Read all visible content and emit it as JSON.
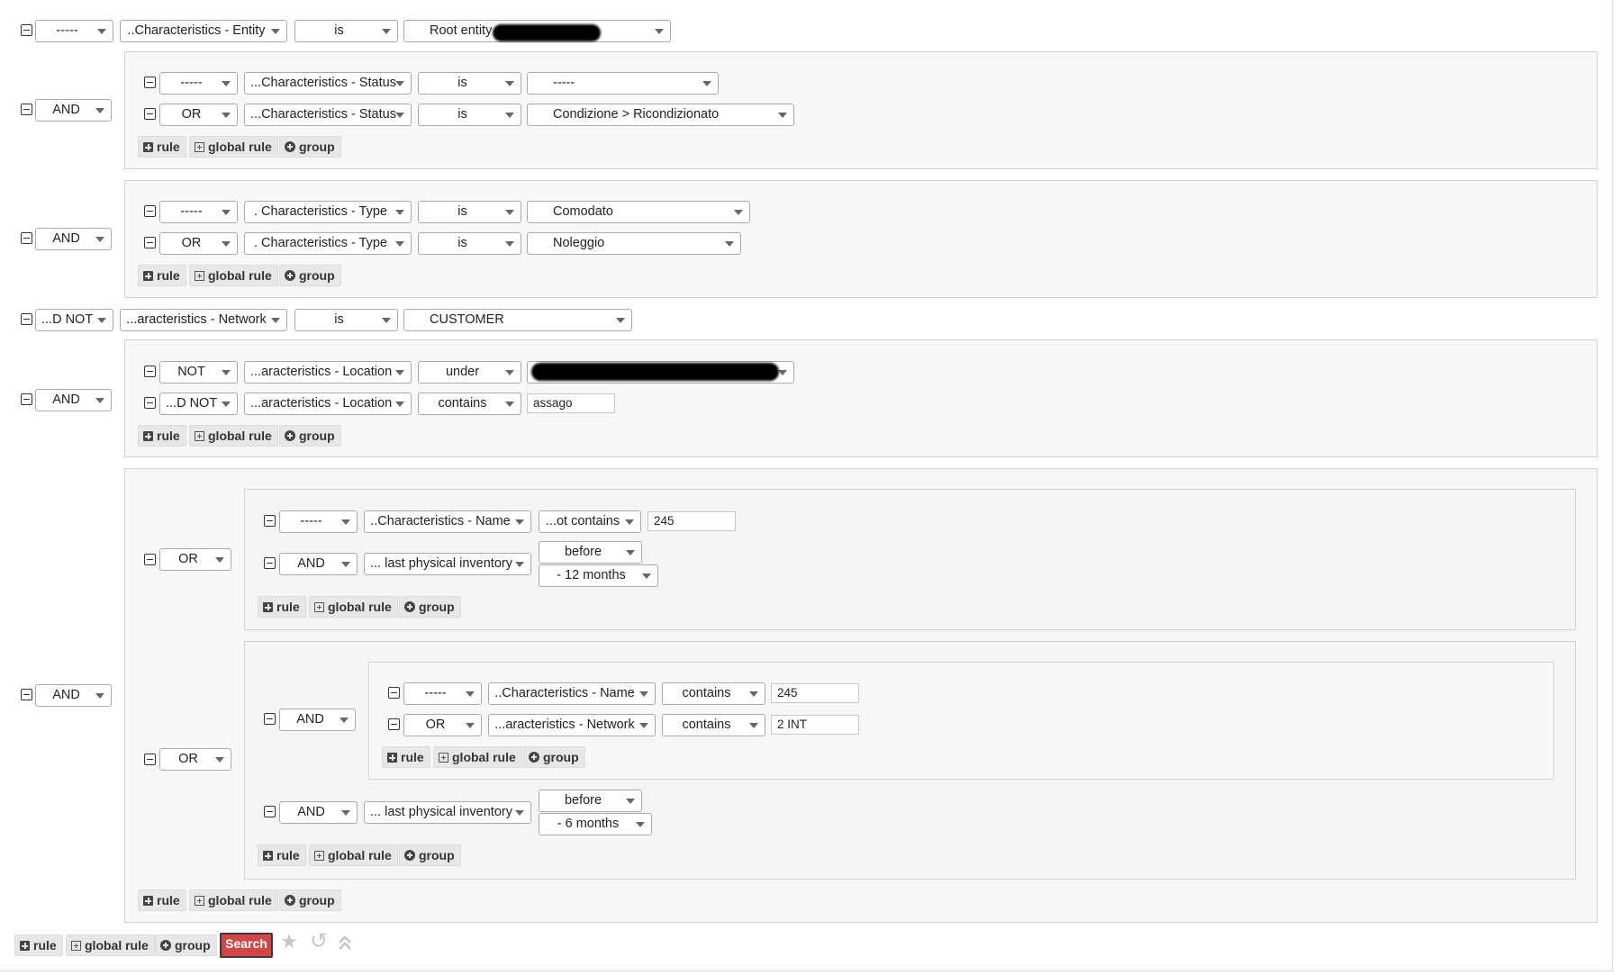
{
  "labels": {
    "dashes": "-----",
    "and": "AND",
    "or": "OR",
    "not": "NOT",
    "and_not": "...D NOT",
    "is": "is",
    "under": "under",
    "contains": "contains",
    "not_contains": "...ot contains",
    "before": "before",
    "add_rule": "rule",
    "add_global_rule": "global rule",
    "add_group": "group",
    "search": "Search"
  },
  "fields": {
    "entity": "..Characteristics - Entity",
    "status": "...Characteristics - Status",
    "type": ".  Characteristics - Type",
    "network": "...aracteristics - Network",
    "location": "...aracteristics - Location",
    "name": "..Characteristics - Name",
    "last_inventory": "... last physical inventory"
  },
  "values": {
    "root_entity": "Root entity",
    "status_empty": "-----",
    "status_condition": "Condizione > Ricondizionato",
    "type_comodato": "Comodato",
    "type_noleggio": "Noleggio",
    "network_customer": "CUSTOMER",
    "location_text": "assago",
    "name_text_1": "245",
    "period_12": "- 12 months",
    "name_text_2": "245",
    "network_text": "2 INT",
    "period_6": "- 6 months"
  },
  "icons": {
    "collapse": "minus-square-icon",
    "rule": "plus-square-icon",
    "global_rule": "plus-square-outline-icon",
    "group": "plus-circle-icon",
    "favorite": "star-icon",
    "reset": "undo-icon",
    "collapse_all": "double-chevron-up-icon"
  }
}
